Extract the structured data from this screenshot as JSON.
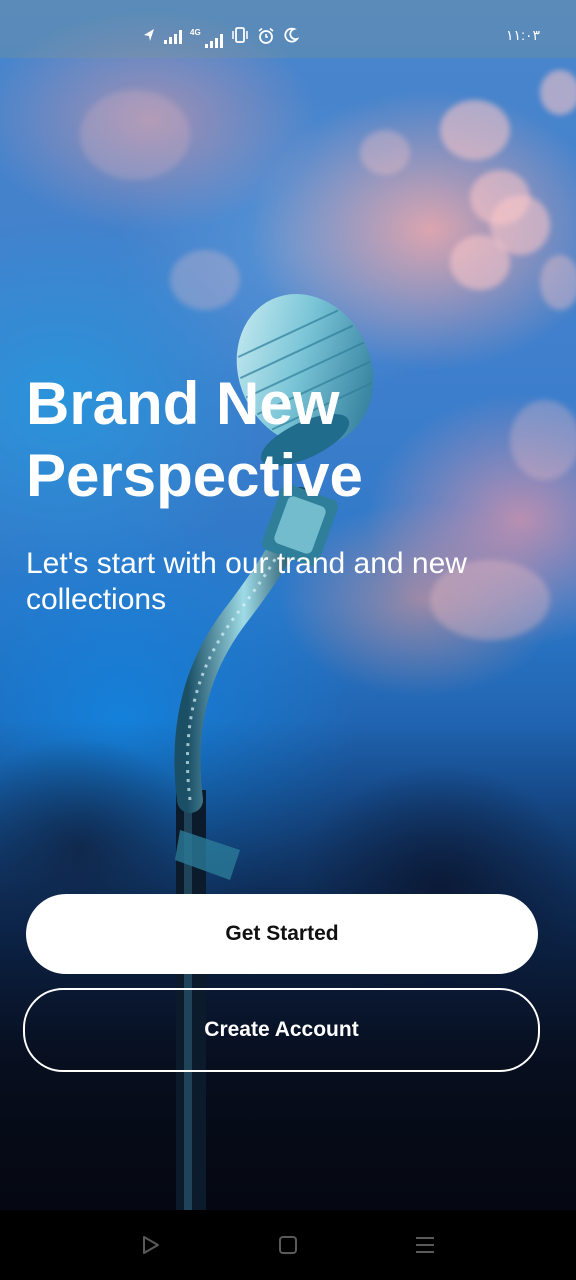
{
  "status_bar": {
    "network_label": "4G",
    "time": "١١:٠٣",
    "icons": [
      "location-icon",
      "signal-icon",
      "network-4g-icon",
      "vibrate-icon",
      "alarm-icon",
      "moon-icon"
    ]
  },
  "hero": {
    "title": "Brand New Perspective",
    "subtitle": "Let's start with our trand and new collections"
  },
  "actions": {
    "primary_label": "Get Started",
    "secondary_label": "Create Account"
  },
  "nav_bar": {
    "icons": [
      "back-triangle-icon",
      "home-square-icon",
      "menu-lines-icon"
    ]
  },
  "colors": {
    "primary_button_bg": "#ffffff",
    "primary_button_text": "#111111",
    "text_on_image": "#ffffff",
    "nav_bar_bg": "#000000"
  }
}
